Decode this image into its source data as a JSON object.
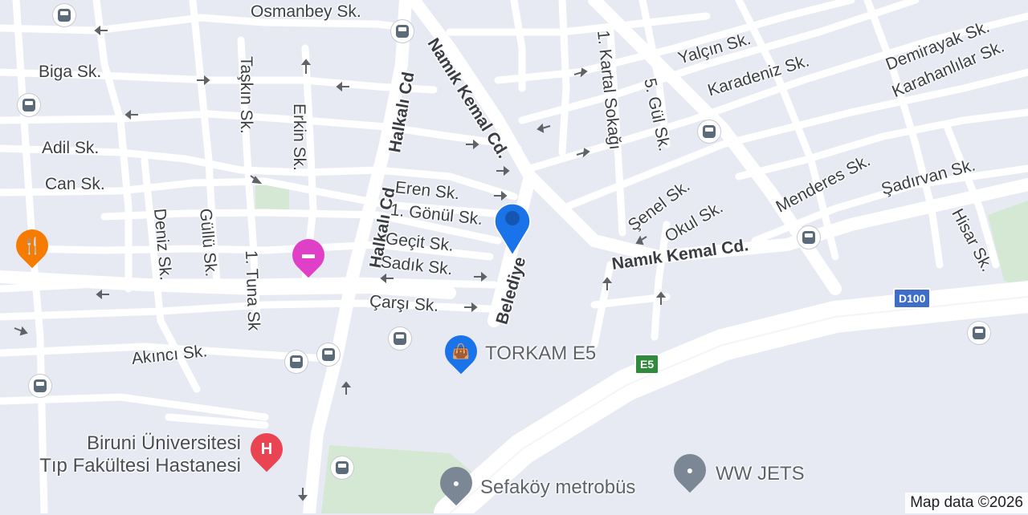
{
  "map": {
    "streets": [
      {
        "id": "osmanbey",
        "text": "Osmanbey Sk."
      },
      {
        "id": "biga",
        "text": "Biga Sk."
      },
      {
        "id": "taskin",
        "text": "Taşkın Sk."
      },
      {
        "id": "erkin",
        "text": "Erkin Sk."
      },
      {
        "id": "halkali1",
        "text": "Halkalı Cd"
      },
      {
        "id": "halkali2",
        "text": "Halkalı Cd"
      },
      {
        "id": "namik1",
        "text": "Namık Kemal Cd."
      },
      {
        "id": "namik2",
        "text": "Namık Kemal Cd."
      },
      {
        "id": "kartal",
        "text": "1. Kartal Sokağı"
      },
      {
        "id": "gul",
        "text": "5. Gül Sk."
      },
      {
        "id": "yalcin",
        "text": "Yalçın Sk."
      },
      {
        "id": "karadeniz",
        "text": "Karadeniz Sk."
      },
      {
        "id": "demirayak",
        "text": "Demirayak Sk."
      },
      {
        "id": "karahanlilar",
        "text": "Karahanlılar Sk."
      },
      {
        "id": "adil",
        "text": "Adil Sk."
      },
      {
        "id": "can",
        "text": "Can Sk."
      },
      {
        "id": "eren",
        "text": "Eren Sk."
      },
      {
        "id": "gonul",
        "text": "1. Gönül Sk."
      },
      {
        "id": "gecit",
        "text": "Geçit Sk."
      },
      {
        "id": "sadik",
        "text": "Sadık Sk."
      },
      {
        "id": "carsi",
        "text": "Çarşı Sk."
      },
      {
        "id": "belediye",
        "text": "Belediye"
      },
      {
        "id": "deniz",
        "text": "Deniz Sk."
      },
      {
        "id": "gullu",
        "text": "Güllü Sk."
      },
      {
        "id": "tuna",
        "text": "1. Tuna Sk"
      },
      {
        "id": "akinci",
        "text": "Akıncı Sk."
      },
      {
        "id": "senel",
        "text": "Şenel Sk."
      },
      {
        "id": "okul",
        "text": "Okul Sk."
      },
      {
        "id": "menderes",
        "text": "Menderes Sk."
      },
      {
        "id": "sadirvan",
        "text": "Şadırvan Sk."
      },
      {
        "id": "hisar",
        "text": "Hisar Sk."
      }
    ],
    "pois": {
      "torkam": "TORKAM E5",
      "hospital_line1": "Biruni Üniversitesi",
      "hospital_line2": "Tıp Fakültesi Hastanesi",
      "metrobus": "Sefaköy metrobüs",
      "wwjets": "WW JETS"
    },
    "shields": {
      "d100": "D100",
      "e5": "E5"
    },
    "attribution": "Map data ©2026",
    "colors": {
      "background": "#e8eaf3",
      "road": "#ffffff",
      "park": "#d5e8d4",
      "bus_icon": "#5c6b7a",
      "restaurant_pin": "#f57c00",
      "hotel_pin": "#e040c8",
      "shopping_pin": "#1a73e8",
      "hospital_pin": "#ea4352",
      "generic_pin": "#7b8794",
      "location_marker": "#1a73e8",
      "d100_shield": "#3f6ec9",
      "e5_shield": "#2f8a3b"
    },
    "icons": [
      "bus-stop-icon",
      "restaurant-icon",
      "hotel-icon",
      "shopping-bag-icon",
      "hospital-icon",
      "place-icon",
      "location-marker-icon",
      "one-way-arrow-icon"
    ]
  }
}
